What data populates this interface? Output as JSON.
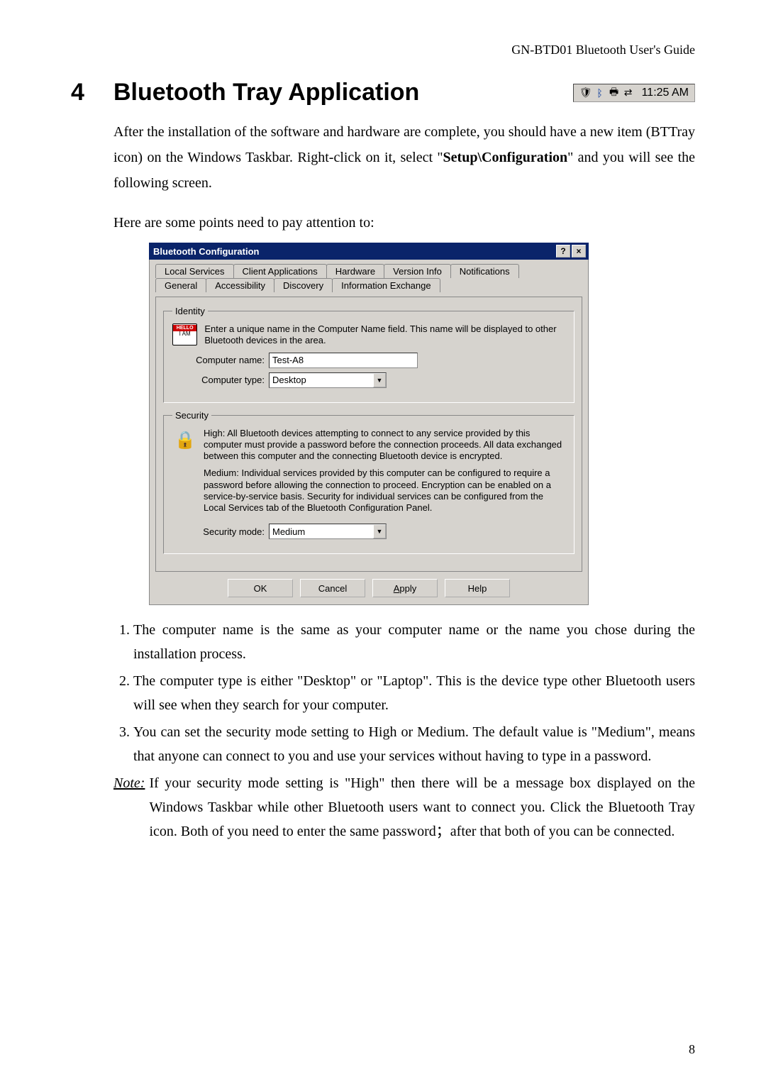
{
  "header": "GN-BTD01 Bluetooth User's Guide",
  "chapter_num": "4",
  "chapter_title": "Bluetooth Tray Application",
  "tray": {
    "time": "11:25 AM"
  },
  "intro1": "After the installation of the software and hardware are complete, you should have a new item (BTTray icon) on the Windows Taskbar. Right-click on it, select \"",
  "intro1_bold": "Setup\\Configuration",
  "intro1_tail": "\" and you will see the following screen.",
  "intro2": "Here are some points need to pay attention to:",
  "dialog": {
    "title": "Bluetooth Configuration",
    "help_btn": "?",
    "close_btn": "×",
    "tabs_row1": [
      "Local Services",
      "Client Applications",
      "Hardware",
      "Version Info",
      "Notifications"
    ],
    "tabs_row2": [
      "General",
      "Accessibility",
      "Discovery",
      "Information Exchange"
    ],
    "identity": {
      "legend": "Identity",
      "badge_top": "HELLO",
      "badge_bottom": "I AM",
      "desc": "Enter a unique name in the Computer Name field. This name will be displayed to other Bluetooth devices in the area.",
      "name_label": "Computer name:",
      "name_value": "Test-A8",
      "type_label": "Computer type:",
      "type_value": "Desktop"
    },
    "security": {
      "legend": "Security",
      "p1": "High: All Bluetooth devices attempting to connect to any service provided by this computer must provide a password before the connection proceeds. All data exchanged between this computer and the connecting Bluetooth device is encrypted.",
      "p2": "Medium: Individual services provided by this computer can be configured to require a password before allowing the connection to proceed. Encryption can be enabled on a service-by-service basis. Security for individual services can be configured from the Local Services tab of the Bluetooth Configuration Panel.",
      "mode_label": "Security mode:",
      "mode_value": "Medium"
    },
    "buttons": {
      "ok": "OK",
      "cancel": "Cancel",
      "apply": "Apply",
      "help": "Help"
    }
  },
  "points": {
    "p1": "The computer name is the same as your computer name or the name you chose during the installation process.",
    "p2": "The computer type is either \"Desktop\" or \"Laptop\". This is the device type other Bluetooth users will see when they search for your computer.",
    "p3": "You can set the security mode setting to High or Medium. The default value is \"Medium\", means that anyone can connect to you and use your services without having to type in a password."
  },
  "note": {
    "label": "Note:",
    "body": "If your security mode setting is \"High\" then there will be a message box displayed on the Windows Taskbar while other Bluetooth users want to connect you. Click the Bluetooth Tray icon. Both of you need to enter the same password；after that both of you can be connected."
  },
  "page_num": "8"
}
